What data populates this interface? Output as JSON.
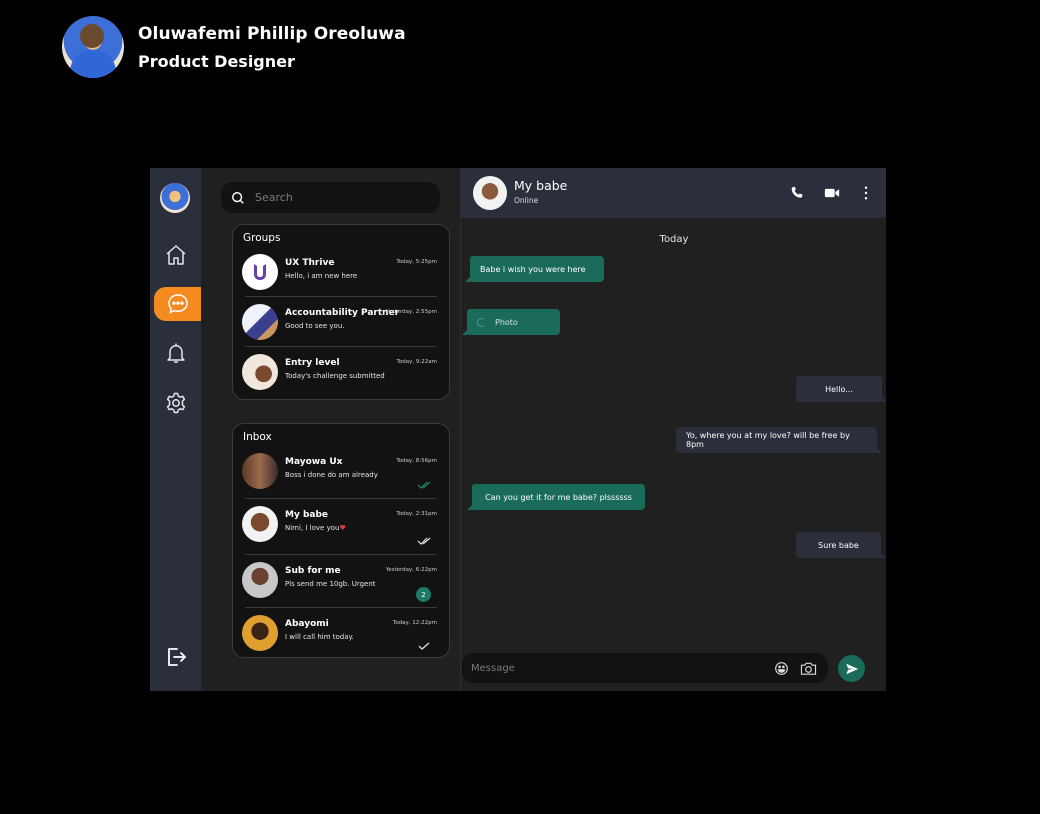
{
  "profile": {
    "name": "Oluwafemi Phillip Oreoluwa",
    "role": "Product Designer"
  },
  "nav": {
    "items": [
      {
        "icon": "home-icon",
        "active": false
      },
      {
        "icon": "chat-icon",
        "active": true
      },
      {
        "icon": "bell-icon",
        "active": false
      },
      {
        "icon": "gear-icon",
        "active": false
      }
    ],
    "logout_icon": "logout-icon"
  },
  "search": {
    "placeholder": "Search",
    "icon": "search-icon"
  },
  "groups": {
    "title": "Groups",
    "items": [
      {
        "name": "UX Thrive",
        "preview": "Hello, i am new here",
        "time": "Today, 5:25pm"
      },
      {
        "name": "Accountability Partner",
        "preview": "Good to see you.",
        "time": "Yesterday, 2:55pm"
      },
      {
        "name": "Entry level",
        "preview": "Today's challenge submitted",
        "time": "Today, 9:22am"
      }
    ]
  },
  "inbox": {
    "title": "Inbox",
    "items": [
      {
        "name": "Mayowa Ux",
        "preview": "Boss i done do am already",
        "time": "Today, 8:56pm",
        "status": "read"
      },
      {
        "name": "My babe",
        "preview": "Nimi, I love you",
        "time": "Today, 2:31pm",
        "status": "delivered"
      },
      {
        "name": "Sub for me",
        "preview": "Pls send me 10gb. Urgent",
        "time": "Yesterday, 6:22pm",
        "unread": "2"
      },
      {
        "name": "Abayomi",
        "preview": "I will call him today.",
        "time": "Today, 12:22pm",
        "status": "sent"
      }
    ]
  },
  "chat": {
    "contact_name": "My babe",
    "contact_status": "Online",
    "day_label": "Today",
    "messages": [
      {
        "direction": "in",
        "text": "Babe i wish you were here"
      },
      {
        "direction": "in",
        "text": "Photo"
      },
      {
        "direction": "out",
        "text": "Hello..."
      },
      {
        "direction": "out",
        "text": "Yo, where you at my love? will be free by 8pm"
      },
      {
        "direction": "in",
        "text": "Can you get it for me babe? plssssss"
      },
      {
        "direction": "out",
        "text": "Sure babe"
      }
    ],
    "composer_placeholder": "Message"
  },
  "colors": {
    "background": "#000000",
    "panel": "#202020",
    "rail": "#2b2f3c",
    "accent": "#f58a1f",
    "incoming_bubble": "#1a6b5a",
    "outgoing_bubble": "#2b2f3c",
    "heart": "#e8393b"
  }
}
